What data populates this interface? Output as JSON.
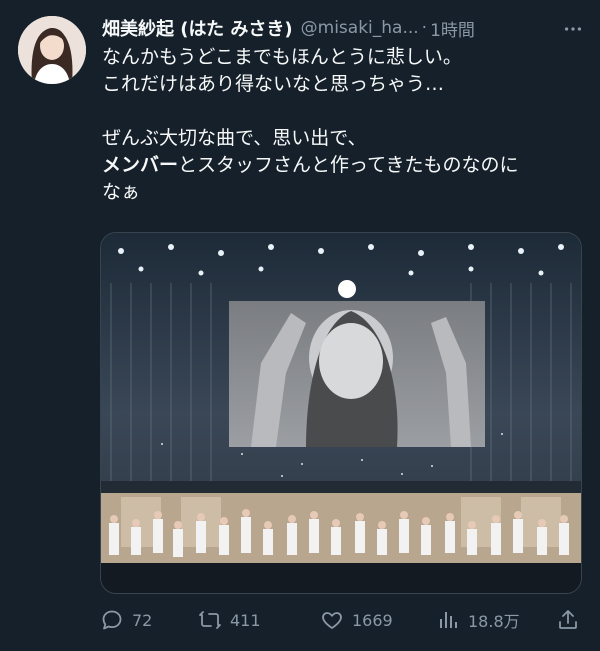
{
  "tweet": {
    "display_name": "畑美紗起 (はた みさき)",
    "handle": "@misaki_ha...",
    "separator": "·",
    "time": "1時間",
    "lines": [
      "なんかもうどこまでもほんとうに悲しい。",
      "これだけはあり得ないなと思っちゃう…"
    ],
    "lines2_a": "ぜんぶ大切な曲で、思い出で、",
    "line_bold": "メンバー",
    "line_rest": "とスタッフさんと作ってきたものなのに",
    "line_last": "なぁ",
    "icons": {
      "more": "more-icon",
      "reply": "reply-icon",
      "retweet": "retweet-icon",
      "like": "heart-icon",
      "views": "analytics-icon",
      "share": "share-icon"
    }
  },
  "actions": {
    "reply_count": "72",
    "retweet_count": "411",
    "like_count": "1669",
    "view_count": "18.8万"
  },
  "colors": {
    "background": "#15202b",
    "text": "#f7f9f9",
    "muted": "#8b98a5"
  }
}
